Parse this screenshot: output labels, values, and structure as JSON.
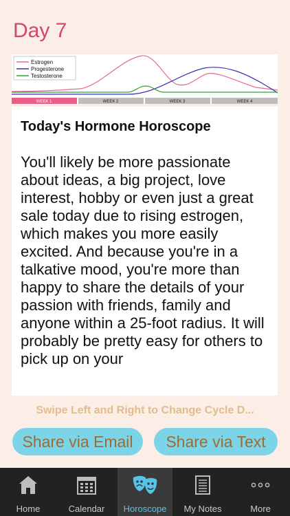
{
  "header": {
    "day_title": "Day 7"
  },
  "chart": {
    "legend": [
      "Estrogen",
      "Progesterone",
      "Testosterone"
    ],
    "colors": {
      "Estrogen": "#e46a93",
      "Progesterone": "#3c2fb6",
      "Testosterone": "#2aa52a"
    },
    "weeks": [
      "WEEK 1",
      "WEEK 2",
      "WEEK 3",
      "WEEK 4"
    ],
    "active_week": "WEEK 1",
    "active_color": "#e86085",
    "inactive_color": "#bdbdbd"
  },
  "horoscope": {
    "title": "Today's Hormone Horoscope",
    "body": "You'll likely be more passionate about ideas, a big project, love interest, hobby or even just a great sale today due to rising estrogen, which makes you more easily excited. And because you're in a talkative mood, you're more than happy to share the details of your passion with friends, family and anyone within a 25-foot radius. It will probably be pretty easy for others to pick up on your"
  },
  "swipe_hint": "Swipe Left and Right to Change Cycle D...",
  "buttons": {
    "email": "Share via Email",
    "text": "Share via Text"
  },
  "tabs": [
    {
      "label": "Home",
      "icon": "home-icon"
    },
    {
      "label": "Calendar",
      "icon": "calendar-icon"
    },
    {
      "label": "Horoscope",
      "icon": "masks-icon",
      "active": true
    },
    {
      "label": "My Notes",
      "icon": "notes-icon"
    },
    {
      "label": "More",
      "icon": "more-icon"
    }
  ]
}
